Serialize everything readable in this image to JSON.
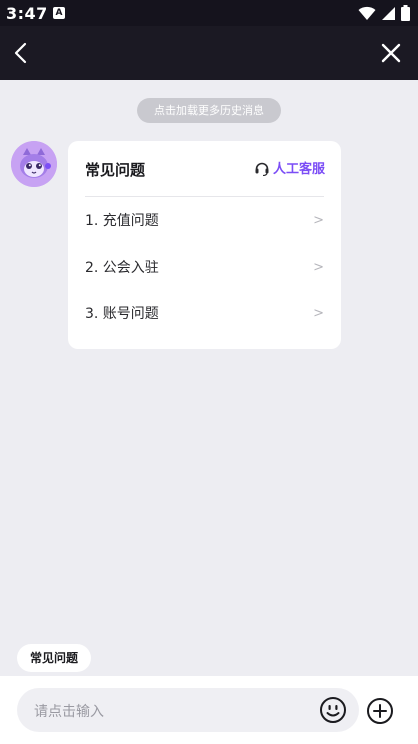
{
  "status_bar": {
    "time": "3:47",
    "notification_icon": "A"
  },
  "chat": {
    "load_history": "点击加载更多历史消息",
    "faq_card": {
      "title": "常见问题",
      "agent_label": "人工客服",
      "items": [
        {
          "label": "1. 充值问题"
        },
        {
          "label": "2. 公会入驻"
        },
        {
          "label": "3. 账号问题"
        }
      ]
    }
  },
  "quick_reply": {
    "label": "常见问题"
  },
  "composer": {
    "placeholder": "请点击输入"
  },
  "colors": {
    "accent": "#7b4df6",
    "header_bg": "#1b1923",
    "chat_bg": "#ededf2"
  }
}
